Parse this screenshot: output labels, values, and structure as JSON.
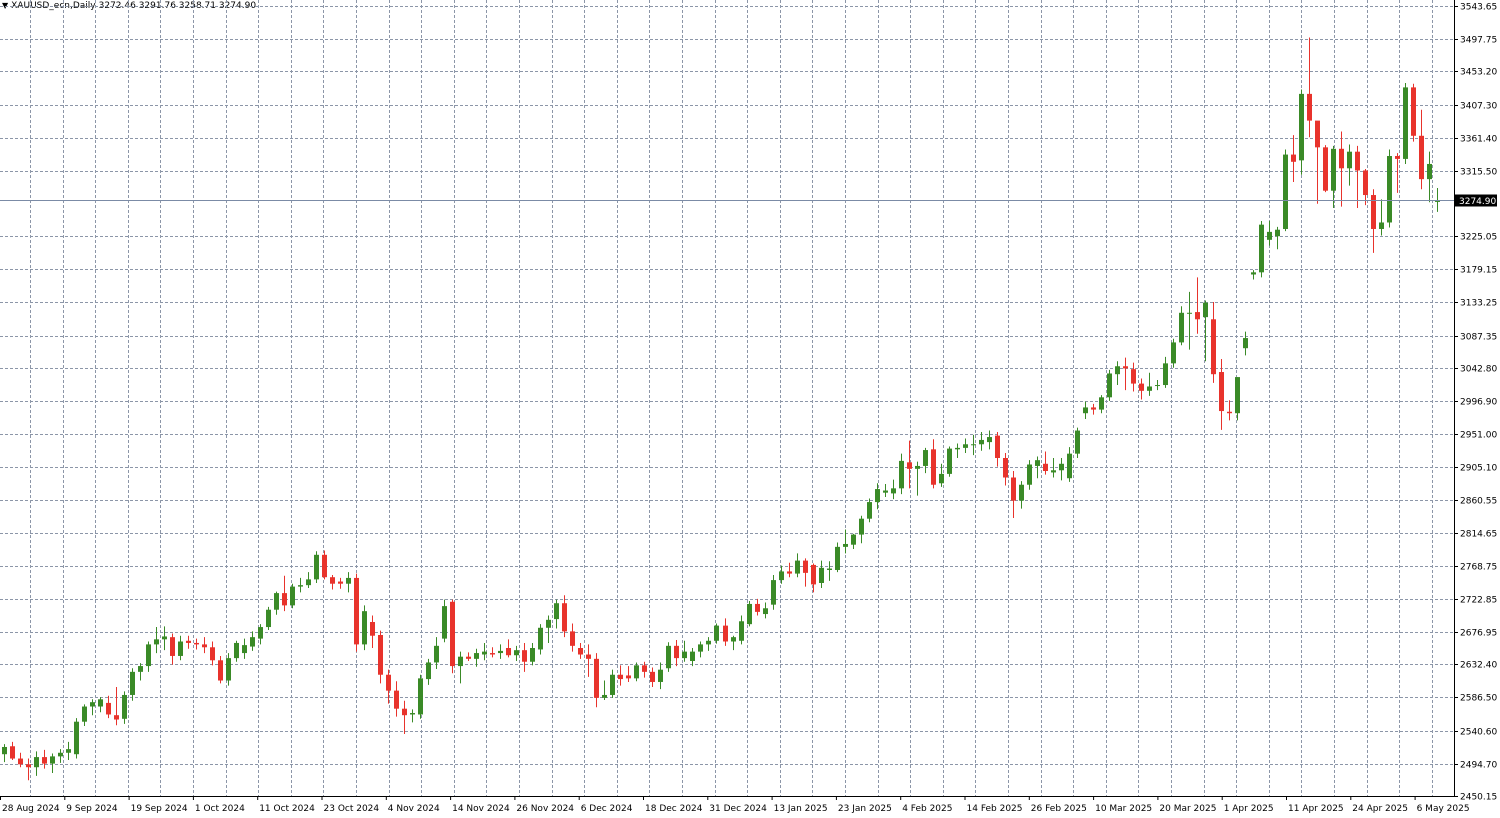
{
  "window": {
    "symbol_label": "XAUUSD_ecn,Daily",
    "ohlc_label": "3272.46 3291.76 3258.71 3274.90",
    "dropdown_icon": "triangle-down-icon"
  },
  "colors": {
    "background": "#ffffff",
    "grid": "#8c96a8",
    "bull": "#3a8a27",
    "bear": "#e8332c",
    "wick": "#3a8a27",
    "axis_text": "#000000",
    "price_line": "#7b8ba6",
    "price_tag_bg": "#000000",
    "price_tag_text": "#ffffff"
  },
  "chart_data": {
    "type": "candlestick",
    "title": "XAUUSD_ecn,Daily",
    "grid": true,
    "ylim": [
      2450.15,
      3543.65
    ],
    "y_ticks": [
      "3543.65",
      "3497.75",
      "3453.20",
      "3407.30",
      "3361.40",
      "3315.50",
      "3225.05",
      "3179.15",
      "3133.25",
      "3087.35",
      "3042.80",
      "2996.90",
      "2951.00",
      "2905.10",
      "2860.55",
      "2814.65",
      "2768.75",
      "2722.85",
      "2676.95",
      "2632.40",
      "2586.50",
      "2540.60",
      "2494.70",
      "2450.15"
    ],
    "x_ticks": [
      "28 Aug 2024",
      "9 Sep 2024",
      "19 Sep 2024",
      "1 Oct 2024",
      "11 Oct 2024",
      "23 Oct 2024",
      "4 Nov 2024",
      "14 Nov 2024",
      "26 Nov 2024",
      "6 Dec 2024",
      "18 Dec 2024",
      "31 Dec 2024",
      "13 Jan 2025",
      "23 Jan 2025",
      "4 Feb 2025",
      "14 Feb 2025",
      "26 Feb 2025",
      "10 Mar 2025",
      "20 Mar 2025",
      "1 Apr 2025",
      "11 Apr 2025",
      "24 Apr 2025",
      "6 May 2025"
    ],
    "current_price": "3274.90",
    "candles": [
      {
        "o": 2508,
        "h": 2522,
        "l": 2497,
        "c": 2518
      },
      {
        "o": 2519,
        "h": 2525,
        "l": 2500,
        "c": 2502
      },
      {
        "o": 2502,
        "h": 2510,
        "l": 2490,
        "c": 2494
      },
      {
        "o": 2494,
        "h": 2502,
        "l": 2472,
        "c": 2490
      },
      {
        "o": 2490,
        "h": 2512,
        "l": 2478,
        "c": 2504
      },
      {
        "o": 2504,
        "h": 2514,
        "l": 2488,
        "c": 2495
      },
      {
        "o": 2495,
        "h": 2509,
        "l": 2482,
        "c": 2505
      },
      {
        "o": 2505,
        "h": 2515,
        "l": 2496,
        "c": 2510
      },
      {
        "o": 2510,
        "h": 2525,
        "l": 2500,
        "c": 2515
      },
      {
        "o": 2508,
        "h": 2558,
        "l": 2502,
        "c": 2553
      },
      {
        "o": 2553,
        "h": 2577,
        "l": 2547,
        "c": 2574
      },
      {
        "o": 2574,
        "h": 2584,
        "l": 2562,
        "c": 2580
      },
      {
        "o": 2574,
        "h": 2587,
        "l": 2566,
        "c": 2584
      },
      {
        "o": 2579,
        "h": 2589,
        "l": 2558,
        "c": 2563
      },
      {
        "o": 2562,
        "h": 2601,
        "l": 2548,
        "c": 2556
      },
      {
        "o": 2557,
        "h": 2595,
        "l": 2550,
        "c": 2590
      },
      {
        "o": 2590,
        "h": 2627,
        "l": 2582,
        "c": 2622
      },
      {
        "o": 2622,
        "h": 2634,
        "l": 2610,
        "c": 2630
      },
      {
        "o": 2630,
        "h": 2664,
        "l": 2622,
        "c": 2660
      },
      {
        "o": 2660,
        "h": 2684,
        "l": 2648,
        "c": 2667
      },
      {
        "o": 2667,
        "h": 2685,
        "l": 2652,
        "c": 2671
      },
      {
        "o": 2670,
        "h": 2675,
        "l": 2632,
        "c": 2644
      },
      {
        "o": 2644,
        "h": 2672,
        "l": 2638,
        "c": 2664
      },
      {
        "o": 2665,
        "h": 2672,
        "l": 2654,
        "c": 2662
      },
      {
        "o": 2662,
        "h": 2668,
        "l": 2653,
        "c": 2660
      },
      {
        "o": 2660,
        "h": 2670,
        "l": 2648,
        "c": 2656
      },
      {
        "o": 2656,
        "h": 2664,
        "l": 2631,
        "c": 2638
      },
      {
        "o": 2638,
        "h": 2644,
        "l": 2606,
        "c": 2610
      },
      {
        "o": 2610,
        "h": 2648,
        "l": 2603,
        "c": 2641
      },
      {
        "o": 2641,
        "h": 2665,
        "l": 2636,
        "c": 2662
      },
      {
        "o": 2648,
        "h": 2668,
        "l": 2640,
        "c": 2659
      },
      {
        "o": 2657,
        "h": 2678,
        "l": 2651,
        "c": 2670
      },
      {
        "o": 2668,
        "h": 2688,
        "l": 2660,
        "c": 2684
      },
      {
        "o": 2684,
        "h": 2712,
        "l": 2680,
        "c": 2708
      },
      {
        "o": 2708,
        "h": 2733,
        "l": 2701,
        "c": 2731
      },
      {
        "o": 2731,
        "h": 2755,
        "l": 2706,
        "c": 2714
      },
      {
        "o": 2714,
        "h": 2744,
        "l": 2710,
        "c": 2740
      },
      {
        "o": 2740,
        "h": 2752,
        "l": 2732,
        "c": 2742
      },
      {
        "o": 2742,
        "h": 2760,
        "l": 2738,
        "c": 2750
      },
      {
        "o": 2750,
        "h": 2789,
        "l": 2745,
        "c": 2784
      },
      {
        "o": 2784,
        "h": 2790,
        "l": 2750,
        "c": 2753
      },
      {
        "o": 2753,
        "h": 2756,
        "l": 2736,
        "c": 2744
      },
      {
        "o": 2747,
        "h": 2752,
        "l": 2737,
        "c": 2744
      },
      {
        "o": 2744,
        "h": 2760,
        "l": 2732,
        "c": 2752
      },
      {
        "o": 2752,
        "h": 2758,
        "l": 2650,
        "c": 2660
      },
      {
        "o": 2660,
        "h": 2714,
        "l": 2652,
        "c": 2706
      },
      {
        "o": 2691,
        "h": 2700,
        "l": 2655,
        "c": 2672
      },
      {
        "o": 2673,
        "h": 2679,
        "l": 2606,
        "c": 2618
      },
      {
        "o": 2618,
        "h": 2625,
        "l": 2578,
        "c": 2596
      },
      {
        "o": 2596,
        "h": 2609,
        "l": 2560,
        "c": 2571
      },
      {
        "o": 2571,
        "h": 2582,
        "l": 2536,
        "c": 2562
      },
      {
        "o": 2563,
        "h": 2570,
        "l": 2552,
        "c": 2565
      },
      {
        "o": 2563,
        "h": 2618,
        "l": 2557,
        "c": 2613
      },
      {
        "o": 2612,
        "h": 2640,
        "l": 2604,
        "c": 2635
      },
      {
        "o": 2635,
        "h": 2670,
        "l": 2626,
        "c": 2658
      },
      {
        "o": 2668,
        "h": 2722,
        "l": 2663,
        "c": 2713
      },
      {
        "o": 2719,
        "h": 2722,
        "l": 2620,
        "c": 2630
      },
      {
        "o": 2630,
        "h": 2650,
        "l": 2606,
        "c": 2643
      },
      {
        "o": 2643,
        "h": 2649,
        "l": 2637,
        "c": 2640
      },
      {
        "o": 2640,
        "h": 2654,
        "l": 2629,
        "c": 2648
      },
      {
        "o": 2646,
        "h": 2662,
        "l": 2638,
        "c": 2650
      },
      {
        "o": 2648,
        "h": 2656,
        "l": 2642,
        "c": 2646
      },
      {
        "o": 2648,
        "h": 2660,
        "l": 2640,
        "c": 2651
      },
      {
        "o": 2655,
        "h": 2667,
        "l": 2642,
        "c": 2645
      },
      {
        "o": 2645,
        "h": 2658,
        "l": 2637,
        "c": 2652
      },
      {
        "o": 2652,
        "h": 2662,
        "l": 2622,
        "c": 2636
      },
      {
        "o": 2636,
        "h": 2662,
        "l": 2631,
        "c": 2655
      },
      {
        "o": 2653,
        "h": 2688,
        "l": 2646,
        "c": 2683
      },
      {
        "o": 2683,
        "h": 2700,
        "l": 2662,
        "c": 2694
      },
      {
        "o": 2695,
        "h": 2722,
        "l": 2682,
        "c": 2717
      },
      {
        "o": 2717,
        "h": 2728,
        "l": 2670,
        "c": 2678
      },
      {
        "o": 2678,
        "h": 2689,
        "l": 2650,
        "c": 2658
      },
      {
        "o": 2655,
        "h": 2662,
        "l": 2640,
        "c": 2646
      },
      {
        "o": 2646,
        "h": 2660,
        "l": 2615,
        "c": 2640
      },
      {
        "o": 2640,
        "h": 2648,
        "l": 2573,
        "c": 2586
      },
      {
        "o": 2586,
        "h": 2610,
        "l": 2583,
        "c": 2590
      },
      {
        "o": 2590,
        "h": 2625,
        "l": 2586,
        "c": 2618
      },
      {
        "o": 2618,
        "h": 2631,
        "l": 2603,
        "c": 2612
      },
      {
        "o": 2617,
        "h": 2630,
        "l": 2608,
        "c": 2613
      },
      {
        "o": 2613,
        "h": 2635,
        "l": 2609,
        "c": 2631
      },
      {
        "o": 2631,
        "h": 2636,
        "l": 2614,
        "c": 2622
      },
      {
        "o": 2622,
        "h": 2628,
        "l": 2601,
        "c": 2608
      },
      {
        "o": 2608,
        "h": 2635,
        "l": 2598,
        "c": 2625
      },
      {
        "o": 2627,
        "h": 2663,
        "l": 2622,
        "c": 2658
      },
      {
        "o": 2658,
        "h": 2666,
        "l": 2630,
        "c": 2641
      },
      {
        "o": 2641,
        "h": 2665,
        "l": 2636,
        "c": 2650
      },
      {
        "o": 2637,
        "h": 2655,
        "l": 2630,
        "c": 2650
      },
      {
        "o": 2650,
        "h": 2664,
        "l": 2642,
        "c": 2660
      },
      {
        "o": 2660,
        "h": 2670,
        "l": 2651,
        "c": 2665
      },
      {
        "o": 2665,
        "h": 2689,
        "l": 2661,
        "c": 2686
      },
      {
        "o": 2686,
        "h": 2696,
        "l": 2658,
        "c": 2664
      },
      {
        "o": 2664,
        "h": 2672,
        "l": 2652,
        "c": 2670
      },
      {
        "o": 2665,
        "h": 2700,
        "l": 2660,
        "c": 2692
      },
      {
        "o": 2688,
        "h": 2720,
        "l": 2685,
        "c": 2716
      },
      {
        "o": 2716,
        "h": 2723,
        "l": 2700,
        "c": 2705
      },
      {
        "o": 2702,
        "h": 2718,
        "l": 2696,
        "c": 2710
      },
      {
        "o": 2715,
        "h": 2756,
        "l": 2708,
        "c": 2749
      },
      {
        "o": 2749,
        "h": 2769,
        "l": 2744,
        "c": 2761
      },
      {
        "o": 2761,
        "h": 2773,
        "l": 2753,
        "c": 2758
      },
      {
        "o": 2758,
        "h": 2786,
        "l": 2753,
        "c": 2776
      },
      {
        "o": 2776,
        "h": 2779,
        "l": 2740,
        "c": 2759
      },
      {
        "o": 2770,
        "h": 2772,
        "l": 2732,
        "c": 2743
      },
      {
        "o": 2745,
        "h": 2776,
        "l": 2738,
        "c": 2766
      },
      {
        "o": 2763,
        "h": 2775,
        "l": 2748,
        "c": 2765
      },
      {
        "o": 2763,
        "h": 2801,
        "l": 2760,
        "c": 2795
      },
      {
        "o": 2795,
        "h": 2819,
        "l": 2786,
        "c": 2799
      },
      {
        "o": 2798,
        "h": 2813,
        "l": 2792,
        "c": 2812
      },
      {
        "o": 2812,
        "h": 2838,
        "l": 2800,
        "c": 2834
      },
      {
        "o": 2834,
        "h": 2862,
        "l": 2829,
        "c": 2857
      },
      {
        "o": 2857,
        "h": 2883,
        "l": 2847,
        "c": 2875
      },
      {
        "o": 2870,
        "h": 2882,
        "l": 2864,
        "c": 2873
      },
      {
        "o": 2869,
        "h": 2888,
        "l": 2861,
        "c": 2876
      },
      {
        "o": 2876,
        "h": 2924,
        "l": 2868,
        "c": 2914
      },
      {
        "o": 2912,
        "h": 2942,
        "l": 2876,
        "c": 2903
      },
      {
        "o": 2903,
        "h": 2913,
        "l": 2866,
        "c": 2907
      },
      {
        "o": 2907,
        "h": 2932,
        "l": 2897,
        "c": 2929
      },
      {
        "o": 2930,
        "h": 2944,
        "l": 2876,
        "c": 2881
      },
      {
        "o": 2883,
        "h": 2910,
        "l": 2878,
        "c": 2896
      },
      {
        "o": 2896,
        "h": 2934,
        "l": 2892,
        "c": 2931
      },
      {
        "o": 2930,
        "h": 2938,
        "l": 2918,
        "c": 2932
      },
      {
        "o": 2932,
        "h": 2945,
        "l": 2925,
        "c": 2937
      },
      {
        "o": 2936,
        "h": 2950,
        "l": 2922,
        "c": 2937
      },
      {
        "o": 2937,
        "h": 2954,
        "l": 2928,
        "c": 2943
      },
      {
        "o": 2940,
        "h": 2956,
        "l": 2930,
        "c": 2947
      },
      {
        "o": 2949,
        "h": 2954,
        "l": 2906,
        "c": 2918
      },
      {
        "o": 2918,
        "h": 2925,
        "l": 2880,
        "c": 2891
      },
      {
        "o": 2891,
        "h": 2900,
        "l": 2835,
        "c": 2859
      },
      {
        "o": 2859,
        "h": 2886,
        "l": 2848,
        "c": 2881
      },
      {
        "o": 2881,
        "h": 2915,
        "l": 2874,
        "c": 2909
      },
      {
        "o": 2907,
        "h": 2920,
        "l": 2890,
        "c": 2915
      },
      {
        "o": 2910,
        "h": 2927,
        "l": 2895,
        "c": 2900
      },
      {
        "o": 2898,
        "h": 2918,
        "l": 2891,
        "c": 2901
      },
      {
        "o": 2901,
        "h": 2918,
        "l": 2887,
        "c": 2910
      },
      {
        "o": 2890,
        "h": 2933,
        "l": 2885,
        "c": 2924
      },
      {
        "o": 2924,
        "h": 2960,
        "l": 2918,
        "c": 2956
      },
      {
        "o": 2980,
        "h": 2996,
        "l": 2972,
        "c": 2988
      },
      {
        "o": 2988,
        "h": 2993,
        "l": 2978,
        "c": 2985
      },
      {
        "o": 2985,
        "h": 3005,
        "l": 2980,
        "c": 3002
      },
      {
        "o": 3002,
        "h": 3040,
        "l": 2997,
        "c": 3035
      },
      {
        "o": 3034,
        "h": 3052,
        "l": 3019,
        "c": 3045
      },
      {
        "o": 3045,
        "h": 3057,
        "l": 3012,
        "c": 3042
      },
      {
        "o": 3041,
        "h": 3050,
        "l": 3010,
        "c": 3021
      },
      {
        "o": 3021,
        "h": 3028,
        "l": 2999,
        "c": 3011
      },
      {
        "o": 3011,
        "h": 3036,
        "l": 3004,
        "c": 3017
      },
      {
        "o": 3018,
        "h": 3026,
        "l": 3012,
        "c": 3019
      },
      {
        "o": 3019,
        "h": 3058,
        "l": 3015,
        "c": 3049
      },
      {
        "o": 3049,
        "h": 3083,
        "l": 3043,
        "c": 3078
      },
      {
        "o": 3078,
        "h": 3128,
        "l": 3074,
        "c": 3119
      },
      {
        "o": 3119,
        "h": 3148,
        "l": 3068,
        "c": 3119
      },
      {
        "o": 3120,
        "h": 3168,
        "l": 3090,
        "c": 3110
      },
      {
        "o": 3113,
        "h": 3136,
        "l": 3052,
        "c": 3133
      },
      {
        "o": 3110,
        "h": 3134,
        "l": 3022,
        "c": 3034
      },
      {
        "o": 3037,
        "h": 3055,
        "l": 2957,
        "c": 2983
      },
      {
        "o": 2982,
        "h": 2998,
        "l": 2970,
        "c": 2980
      },
      {
        "o": 2980,
        "h": 3030,
        "l": 2970,
        "c": 3030
      },
      {
        "o": 3070,
        "h": 3093,
        "l": 3060,
        "c": 3084
      },
      {
        "o": 3172,
        "h": 3178,
        "l": 3165,
        "c": 3175
      },
      {
        "o": 3175,
        "h": 3246,
        "l": 3168,
        "c": 3241
      },
      {
        "o": 3220,
        "h": 3246,
        "l": 3212,
        "c": 3231
      },
      {
        "o": 3225,
        "h": 3238,
        "l": 3207,
        "c": 3234
      },
      {
        "o": 3235,
        "h": 3345,
        "l": 3232,
        "c": 3338
      },
      {
        "o": 3338,
        "h": 3365,
        "l": 3300,
        "c": 3328
      },
      {
        "o": 3330,
        "h": 3428,
        "l": 3310,
        "c": 3422
      },
      {
        "o": 3422,
        "h": 3500,
        "l": 3362,
        "c": 3385
      },
      {
        "o": 3385,
        "h": 3382,
        "l": 3270,
        "c": 3348
      },
      {
        "o": 3348,
        "h": 3351,
        "l": 3286,
        "c": 3288
      },
      {
        "o": 3288,
        "h": 3350,
        "l": 3264,
        "c": 3346
      },
      {
        "o": 3346,
        "h": 3370,
        "l": 3266,
        "c": 3319
      },
      {
        "o": 3319,
        "h": 3352,
        "l": 3295,
        "c": 3342
      },
      {
        "o": 3342,
        "h": 3350,
        "l": 3264,
        "c": 3316
      },
      {
        "o": 3316,
        "h": 3318,
        "l": 3268,
        "c": 3282
      },
      {
        "o": 3282,
        "h": 3290,
        "l": 3202,
        "c": 3235
      },
      {
        "o": 3235,
        "h": 3276,
        "l": 3226,
        "c": 3244
      },
      {
        "o": 3244,
        "h": 3345,
        "l": 3237,
        "c": 3336
      },
      {
        "o": 3336,
        "h": 3340,
        "l": 3285,
        "c": 3332
      },
      {
        "o": 3332,
        "h": 3437,
        "l": 3325,
        "c": 3431
      },
      {
        "o": 3431,
        "h": 3436,
        "l": 3356,
        "c": 3364
      },
      {
        "o": 3364,
        "h": 3400,
        "l": 3290,
        "c": 3304
      },
      {
        "o": 3304,
        "h": 3342,
        "l": 3272,
        "c": 3325
      },
      {
        "o": 3272.46,
        "h": 3291.76,
        "l": 3258.71,
        "c": 3274.9
      }
    ]
  }
}
